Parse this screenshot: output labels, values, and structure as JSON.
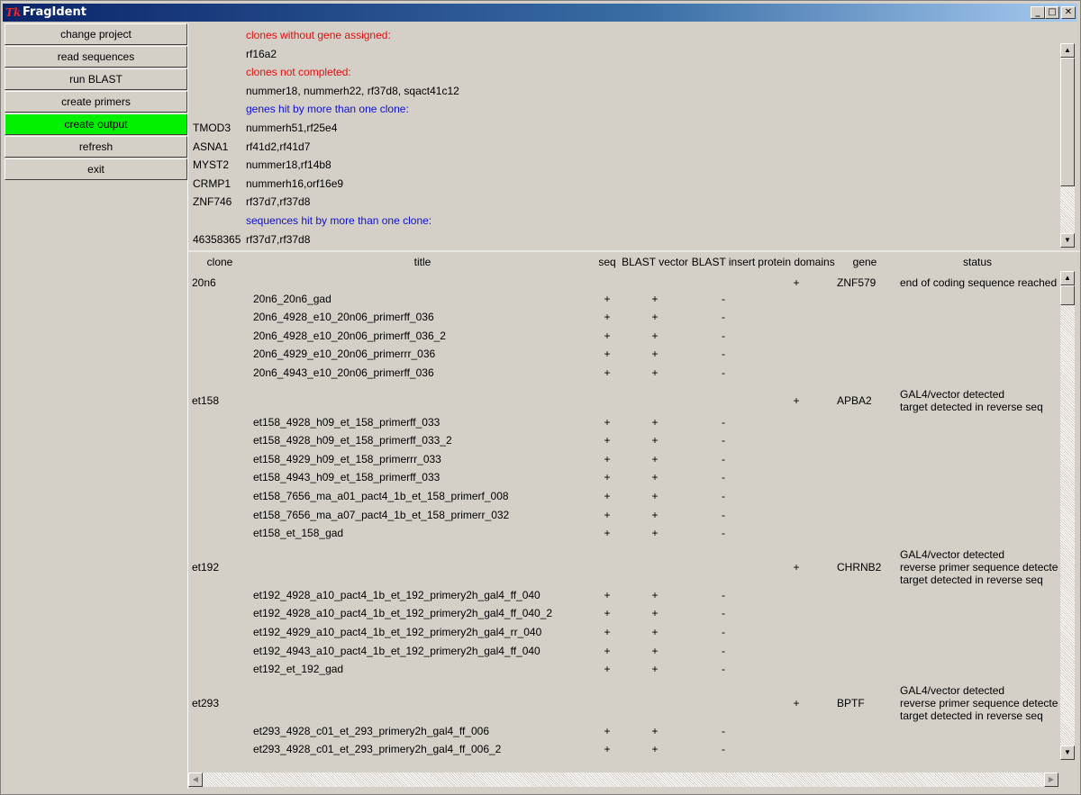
{
  "window": {
    "title": "FragIdent",
    "app_icon": "Tk",
    "controls": {
      "minimize": "_",
      "maximize": "□",
      "close": "✕"
    }
  },
  "sidebar": {
    "buttons": [
      {
        "label": "change project",
        "active": false
      },
      {
        "label": "read sequences",
        "active": false
      },
      {
        "label": "run BLAST",
        "active": false
      },
      {
        "label": "create primers",
        "active": false
      },
      {
        "label": "create output",
        "active": true
      },
      {
        "label": "refresh",
        "active": false
      },
      {
        "label": "exit",
        "active": false
      }
    ],
    "active_color": "#00f000"
  },
  "summary": {
    "rows": [
      {
        "key": "",
        "value": "clones without gene assigned:",
        "style": "red"
      },
      {
        "key": "",
        "value": "rf16a2",
        "style": ""
      },
      {
        "key": "",
        "value": "clones not completed:",
        "style": "red"
      },
      {
        "key": "",
        "value": "nummer18, nummerh22, rf37d8, sqact41c12",
        "style": ""
      },
      {
        "key": "",
        "value": "genes hit by more than one clone:",
        "style": "blue"
      },
      {
        "key": "TMOD3",
        "value": "nummerh51,rf25e4",
        "style": ""
      },
      {
        "key": "ASNA1",
        "value": "rf41d2,rf41d7",
        "style": ""
      },
      {
        "key": "MYST2",
        "value": "nummer18,rf14b8",
        "style": ""
      },
      {
        "key": "CRMP1",
        "value": "nummerh16,orf16e9",
        "style": ""
      },
      {
        "key": "ZNF746",
        "value": "rf37d7,rf37d8",
        "style": ""
      },
      {
        "key": "",
        "value": "sequences hit by more than one clone:",
        "style": "blue"
      },
      {
        "key": "46358365",
        "value": "rf37d7,rf37d8",
        "style": ""
      }
    ]
  },
  "table": {
    "headers": {
      "clone": "clone",
      "title": "title",
      "seq": "seq",
      "blast_vector": "BLAST vector",
      "blast_insert": "BLAST insert",
      "protein_domains": "protein domains",
      "gene": "gene",
      "status": "status"
    },
    "clones": [
      {
        "clone": "20n6",
        "protein_domains": "+",
        "gene": "ZNF579",
        "status": [
          "end of coding sequence reached"
        ],
        "sequences": [
          {
            "title": "20n6_20n6_gad",
            "seq": "+",
            "blast_vector": "+",
            "blast_insert": "-"
          },
          {
            "title": "20n6_4928_e10_20n06_primerff_036",
            "seq": "+",
            "blast_vector": "+",
            "blast_insert": "-"
          },
          {
            "title": "20n6_4928_e10_20n06_primerff_036_2",
            "seq": "+",
            "blast_vector": "+",
            "blast_insert": "-"
          },
          {
            "title": "20n6_4929_e10_20n06_primerrr_036",
            "seq": "+",
            "blast_vector": "+",
            "blast_insert": "-"
          },
          {
            "title": "20n6_4943_e10_20n06_primerff_036",
            "seq": "+",
            "blast_vector": "+",
            "blast_insert": "-"
          }
        ]
      },
      {
        "clone": "et158",
        "protein_domains": "+",
        "gene": "APBA2",
        "status": [
          "GAL4/vector detected",
          "target detected in reverse seq"
        ],
        "sequences": [
          {
            "title": "et158_4928_h09_et_158_primerff_033",
            "seq": "+",
            "blast_vector": "+",
            "blast_insert": "-"
          },
          {
            "title": "et158_4928_h09_et_158_primerff_033_2",
            "seq": "+",
            "blast_vector": "+",
            "blast_insert": "-"
          },
          {
            "title": "et158_4929_h09_et_158_primerrr_033",
            "seq": "+",
            "blast_vector": "+",
            "blast_insert": "-"
          },
          {
            "title": "et158_4943_h09_et_158_primerff_033",
            "seq": "+",
            "blast_vector": "+",
            "blast_insert": "-"
          },
          {
            "title": "et158_7656_ma_a01_pact4_1b_et_158_primerf_008",
            "seq": "+",
            "blast_vector": "+",
            "blast_insert": "-"
          },
          {
            "title": "et158_7656_ma_a07_pact4_1b_et_158_primerr_032",
            "seq": "+",
            "blast_vector": "+",
            "blast_insert": "-"
          },
          {
            "title": "et158_et_158_gad",
            "seq": "+",
            "blast_vector": "+",
            "blast_insert": "-"
          }
        ]
      },
      {
        "clone": "et192",
        "protein_domains": "+",
        "gene": "CHRNB2",
        "status": [
          "GAL4/vector detected",
          "reverse primer sequence detected",
          "target detected in reverse seq"
        ],
        "sequences": [
          {
            "title": "et192_4928_a10_pact4_1b_et_192_primery2h_gal4_ff_040",
            "seq": "+",
            "blast_vector": "+",
            "blast_insert": "-"
          },
          {
            "title": "et192_4928_a10_pact4_1b_et_192_primery2h_gal4_ff_040_2",
            "seq": "+",
            "blast_vector": "+",
            "blast_insert": "-"
          },
          {
            "title": "et192_4929_a10_pact4_1b_et_192_primery2h_gal4_rr_040",
            "seq": "+",
            "blast_vector": "+",
            "blast_insert": "-"
          },
          {
            "title": "et192_4943_a10_pact4_1b_et_192_primery2h_gal4_ff_040",
            "seq": "+",
            "blast_vector": "+",
            "blast_insert": "-"
          },
          {
            "title": "et192_et_192_gad",
            "seq": "+",
            "blast_vector": "+",
            "blast_insert": "-"
          }
        ]
      },
      {
        "clone": "et293",
        "protein_domains": "+",
        "gene": "BPTF",
        "status": [
          "GAL4/vector detected",
          "reverse primer sequence detected",
          "target detected in reverse seq"
        ],
        "sequences": [
          {
            "title": "et293_4928_c01_et_293_primery2h_gal4_ff_006",
            "seq": "+",
            "blast_vector": "+",
            "blast_insert": "-"
          },
          {
            "title": "et293_4928_c01_et_293_primery2h_gal4_ff_006_2",
            "seq": "+",
            "blast_vector": "+",
            "blast_insert": "-"
          }
        ]
      }
    ]
  },
  "scrollbars": {
    "up_arrow": "▲",
    "down_arrow": "▼",
    "left_arrow": "◀",
    "right_arrow": "▶"
  }
}
